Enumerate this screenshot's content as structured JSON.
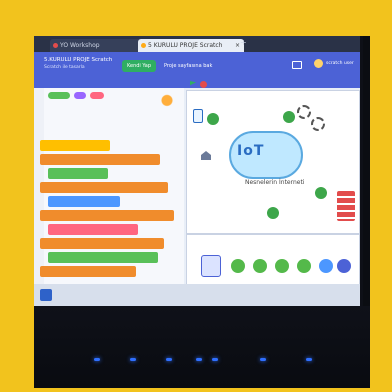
{
  "browser": {
    "tabs": [
      {
        "label": "YO Workshop"
      },
      {
        "label": "5 KURULU PROJE Scratch"
      }
    ]
  },
  "topbar": {
    "project_title": "5.KURULU PROJE Scratch",
    "project_subtitle": "Scratch ile tasarla",
    "green_button": "Kendi Yap",
    "project_page_link": "Proje sayfasına bak",
    "username": "scratch user"
  },
  "stage": {
    "graphic_text": "IoT",
    "graphic_subtext": "Nesnelerin İnterneti"
  },
  "colors": {
    "accent": "#4c62d6",
    "green": "#2fae62",
    "block_orange": "#f08c2c",
    "block_pink": "#ff6680",
    "frame": "#f2c31d"
  }
}
